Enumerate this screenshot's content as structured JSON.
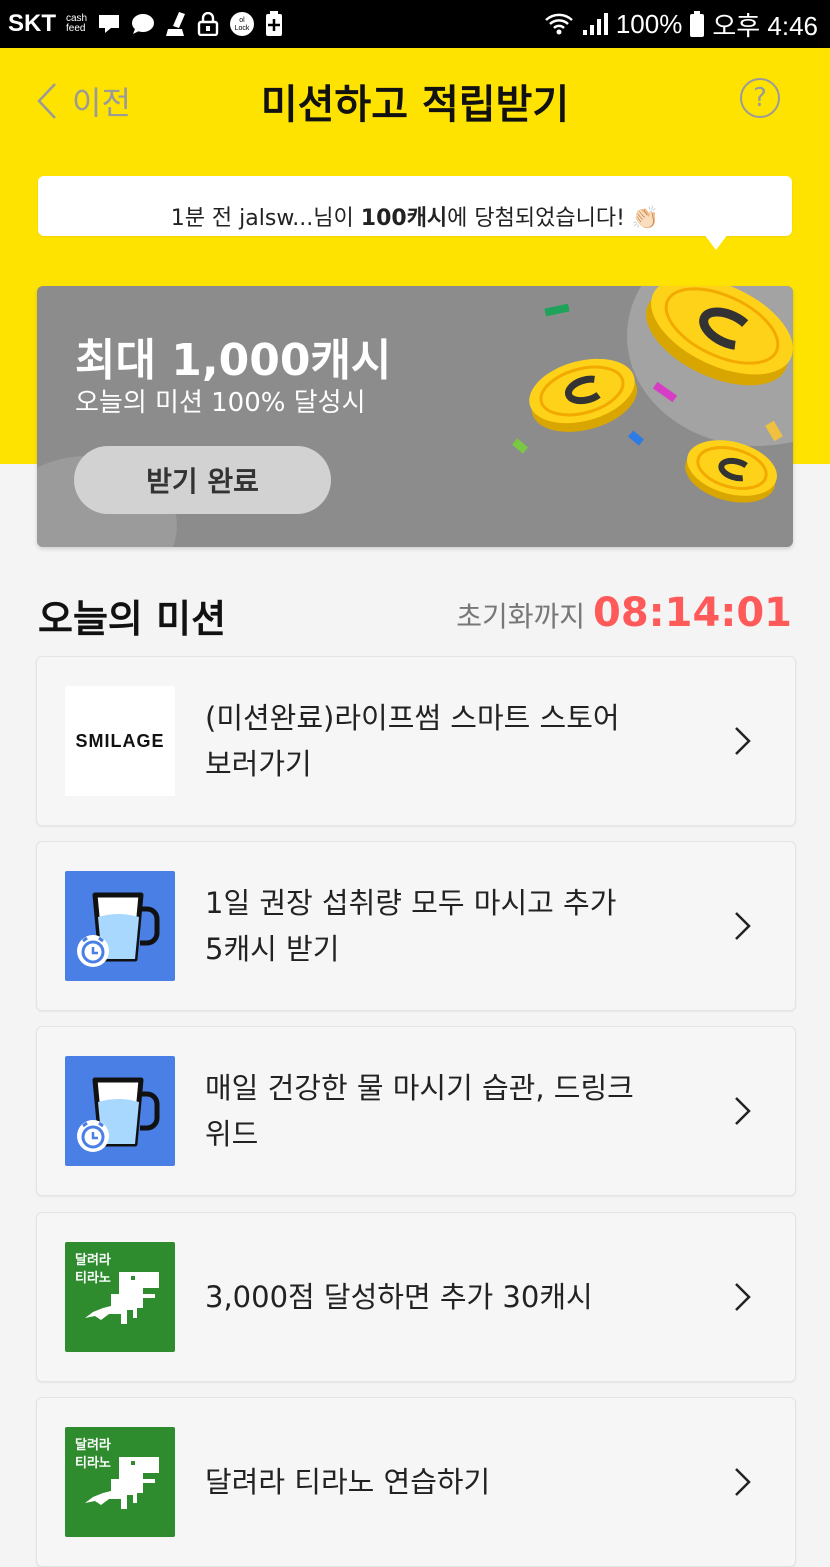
{
  "status_bar": {
    "carrier": "SKT",
    "cashfeed_line1": "cash",
    "cashfeed_line2": "feed",
    "battery": "100%",
    "time": "오후 4:46"
  },
  "header": {
    "back_label": "이전",
    "title": "미션하고 적립받기",
    "help": "?"
  },
  "notice": {
    "text_before": "1분 전 jalsw...님이 ",
    "highlight": "100캐시",
    "text_after": "에 당첨되었습니다! 👏🏻"
  },
  "banner": {
    "title": "최대 1,000캐시",
    "subtitle": "오늘의 미션 100% 달성시",
    "button_label": "받기 완료"
  },
  "missions_section": {
    "title": "오늘의 미션",
    "reset_label": "초기화까지",
    "reset_time": "08:14:01"
  },
  "missions": [
    {
      "icon": "smilage-logo",
      "icon_text": "SMILAGE",
      "line1": "(미션완료)라이프썸 스마트 스토어",
      "line2": "보러가기"
    },
    {
      "icon": "water-cup-alarm-icon",
      "line1": "1일 권장 섭취량 모두 마시고 추가",
      "line2": "5캐시 받기"
    },
    {
      "icon": "water-cup-alarm-icon",
      "line1": "매일 건강한 물 마시기 습관, 드링크",
      "line2": "위드"
    },
    {
      "icon": "dino-game-icon",
      "icon_text_1": "달려라",
      "icon_text_2": "티라노",
      "line1": "3,000점 달성하면 추가 30캐시",
      "line2": ""
    },
    {
      "icon": "dino-game-icon",
      "icon_text_1": "달려라",
      "icon_text_2": "티라노",
      "line1": "달려라 티라노 연습하기",
      "line2": ""
    }
  ],
  "colors": {
    "accent_yellow": "#ffe300",
    "timer_red": "#ff5a5a",
    "banner_gray": "#8c8c8c"
  }
}
